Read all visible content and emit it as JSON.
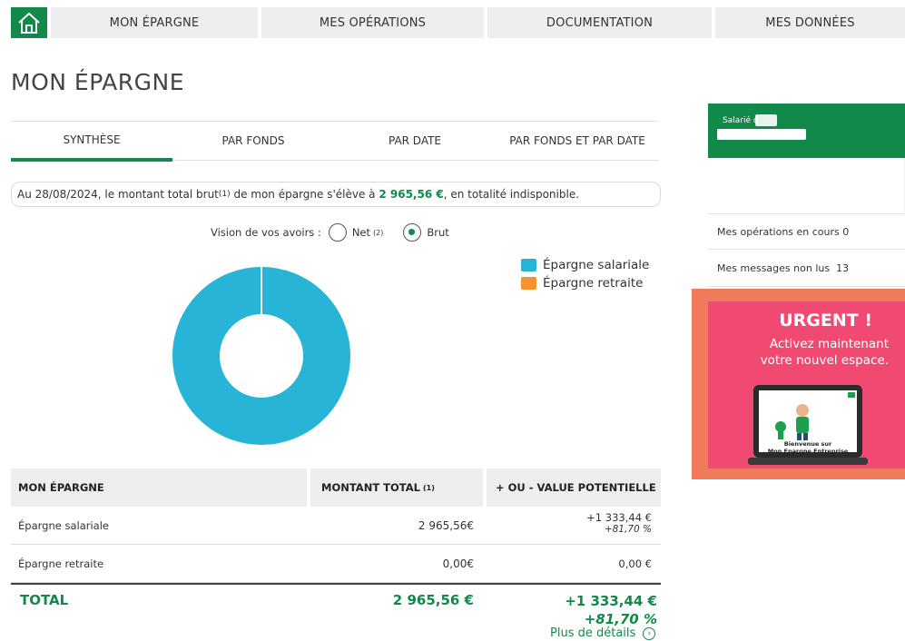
{
  "nav": {
    "items": [
      {
        "label": "MON ÉPARGNE"
      },
      {
        "label": "MES OPÉRATIONS"
      },
      {
        "label": "DOCUMENTATION"
      },
      {
        "label": "MES DONNÉES"
      }
    ]
  },
  "page": {
    "title": "MON ÉPARGNE"
  },
  "tabs": [
    {
      "label": "SYNTHÈSE",
      "active": true
    },
    {
      "label": "PAR FONDS"
    },
    {
      "label": "PAR DATE"
    },
    {
      "label": "PAR FONDS ET PAR DATE"
    }
  ],
  "summary": {
    "prefix": "Au 28/08/2024, le montant total brut",
    "note": "(1)",
    "middle": " de mon épargne s'élève à ",
    "amount": "2 965,56 €",
    "suffix": ", en totalité indisponible."
  },
  "vision": {
    "label": "Vision de vos avoirs :",
    "net_label": "Net",
    "net_note": "(2)",
    "brut_label": "Brut",
    "selected": "Brut"
  },
  "chart_data": {
    "type": "pie",
    "donut": true,
    "categories": [
      "Épargne salariale",
      "Épargne retraite"
    ],
    "values": [
      2965.56,
      0.0
    ],
    "colors": [
      "#27b4d6",
      "#f59231"
    ],
    "legend": "top-right"
  },
  "table": {
    "headers": {
      "col1": "MON ÉPARGNE",
      "col2": "MONTANT TOTAL",
      "col2_note": "(1)",
      "col3": "+ OU - VALUE POTENTIELLE"
    },
    "rows": [
      {
        "label": "Épargne salariale",
        "montant": "2 965,56€",
        "pv": "+1 333,44 €",
        "pv_pct": "+81,70 %"
      },
      {
        "label": "Épargne retraite",
        "montant": "0,00€",
        "pv": "0,00 €"
      }
    ],
    "total": {
      "label": "TOTAL",
      "montant": "2 965,56 €",
      "pv": "+1 333,44 €",
      "pv_pct": "+81,70 %"
    }
  },
  "details": {
    "label": "Plus de détails"
  },
  "sidepanel": {
    "salarie_label": "Salarié d",
    "operations_label": "Mes opérations en cours",
    "operations_count": "0",
    "messages_label": "Mes messages non lus",
    "messages_count": "13"
  },
  "promo": {
    "title": "URGENT !",
    "line1": "Activez maintenant",
    "line2": "votre nouvel espace.",
    "screen_line1": "Bienvenue sur",
    "screen_line2": "Mon Epargne Entreprise"
  },
  "colors": {
    "brand_green": "#10894a",
    "salariale": "#27b4d6",
    "retraite": "#f59231",
    "promo_pink": "#f04a72",
    "promo_frame": "#f07a5c"
  }
}
